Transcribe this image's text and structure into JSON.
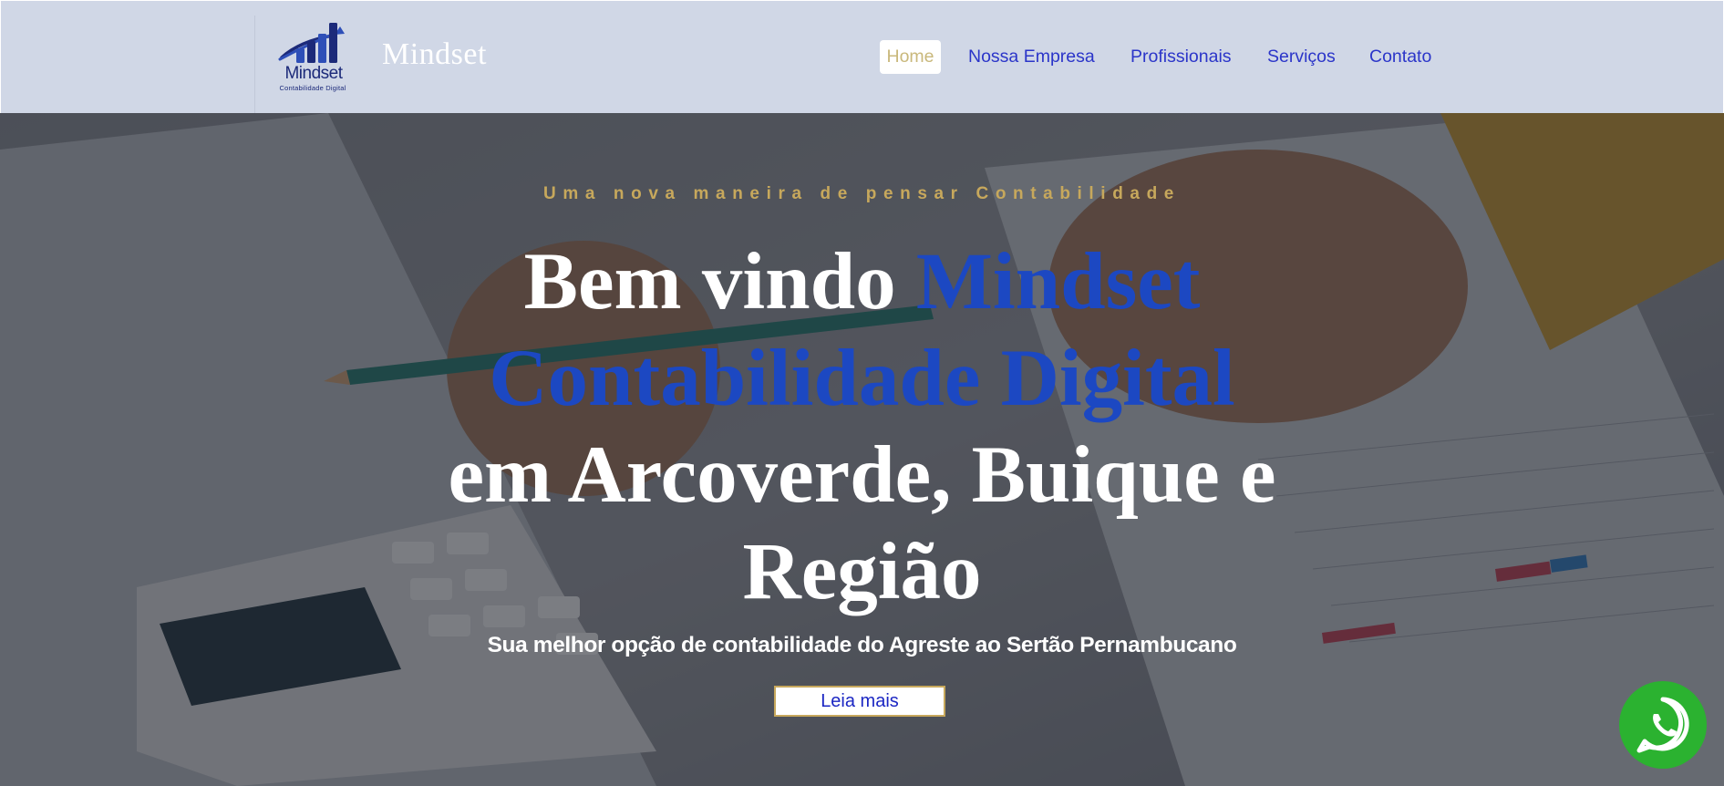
{
  "header": {
    "logo": {
      "icon": "bar-chart-arrow-logo",
      "wordmark": "Mindset",
      "tagline": "Contabilidade Digital"
    },
    "site_name": "Mindset",
    "nav": [
      {
        "label": "Home",
        "active": true
      },
      {
        "label": "Nossa Empresa",
        "active": false
      },
      {
        "label": "Profissionais",
        "active": false
      },
      {
        "label": "Serviços",
        "active": false
      },
      {
        "label": "Contato",
        "active": false
      }
    ]
  },
  "hero": {
    "background": "photo-hands-calculator-pencil-financial-charts",
    "eyebrow": "Uma nova maneira de pensar Contabilidade",
    "headline": {
      "prefix": "Bem vindo ",
      "highlight": "Mindset Contabilidade Digital",
      "suffix": "em Arcoverde, Buique e Região"
    },
    "subheadline": "Sua melhor opção de contabilidade do Agreste ao Sertão Pernambucano",
    "cta_label": "Leia mais"
  },
  "floating": {
    "icon": "whatsapp-icon"
  },
  "colors": {
    "header_bg": "#d0d7e6",
    "nav_link": "#2b35c9",
    "nav_active": "#c9b87b",
    "accent_blue": "#1c48c2",
    "gold": "#c7a85c",
    "whatsapp_green": "#2bb230"
  }
}
